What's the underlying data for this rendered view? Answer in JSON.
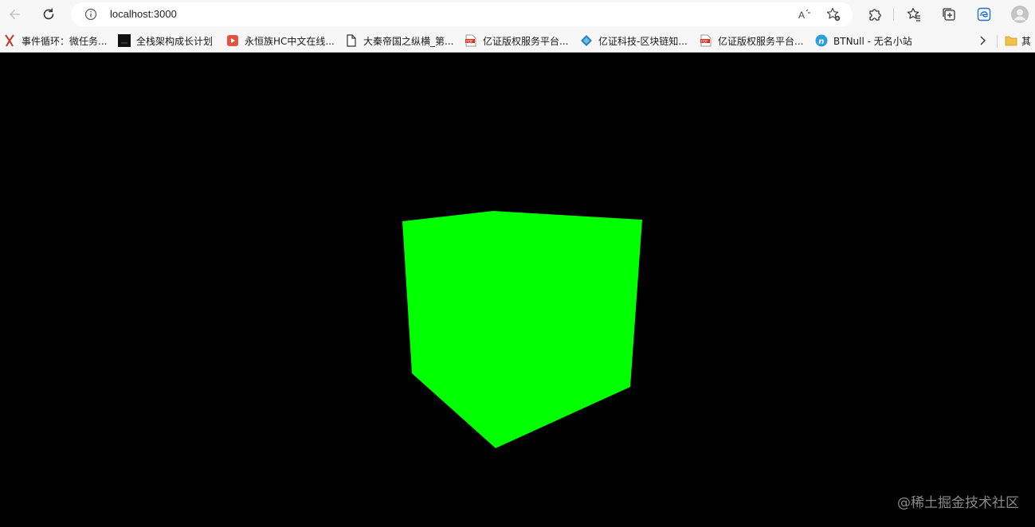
{
  "browser": {
    "url": "localhost:3000"
  },
  "bookmarks": [
    {
      "label": "事件循环：微任务...",
      "icon": "shuriken-icon"
    },
    {
      "label": "全栈架构成长计划",
      "icon": "black-square-icon"
    },
    {
      "label": "永恒族HC中文在线...",
      "icon": "play-icon"
    },
    {
      "label": "大秦帝国之纵横_第...",
      "icon": "document-icon"
    },
    {
      "label": "亿证版权服务平台...",
      "icon": "pdf-icon"
    },
    {
      "label": "亿证科技-区块链知...",
      "icon": "diamond-icon"
    },
    {
      "label": "亿证版权服务平台...",
      "icon": "pdf-icon"
    },
    {
      "label": "BTNull - 无名小站",
      "icon": "n-circle-icon"
    }
  ],
  "overflow_folder_label": "其",
  "scene": {
    "object": "cube",
    "color": "#00ff00",
    "background": "#000000"
  },
  "watermark": "@稀土掘金技术社区"
}
